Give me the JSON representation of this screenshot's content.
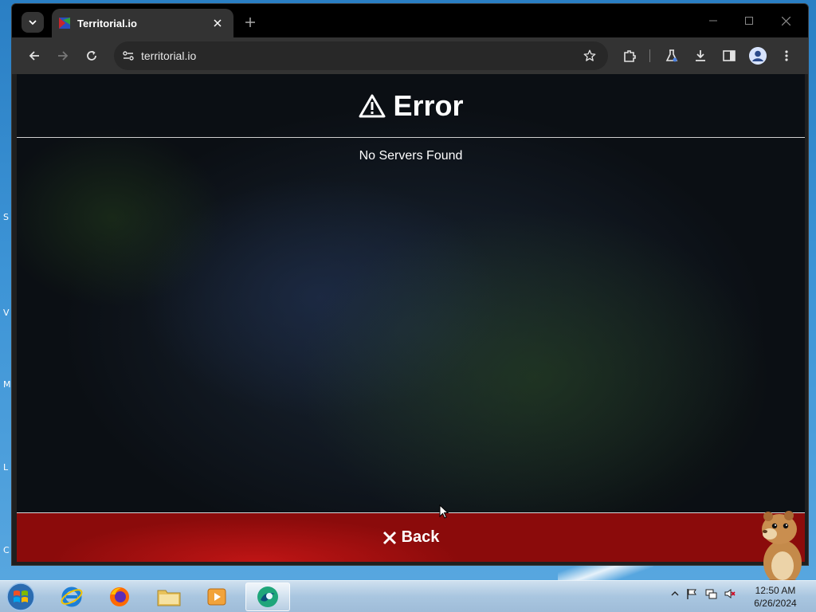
{
  "browser": {
    "tab_title": "Territorial.io",
    "url": "territorial.io"
  },
  "page": {
    "error_title": "Error",
    "error_message": "No Servers Found",
    "back_label": "Back"
  },
  "taskbar": {
    "time": "12:50 AM",
    "date": "6/26/2024"
  },
  "desktop": {
    "edge_letters": [
      "S",
      "V",
      "M",
      "L",
      "C"
    ]
  },
  "colors": {
    "back_button": "#a80f0f",
    "tab_bg": "#333333",
    "toolbar_bg": "#333333"
  }
}
